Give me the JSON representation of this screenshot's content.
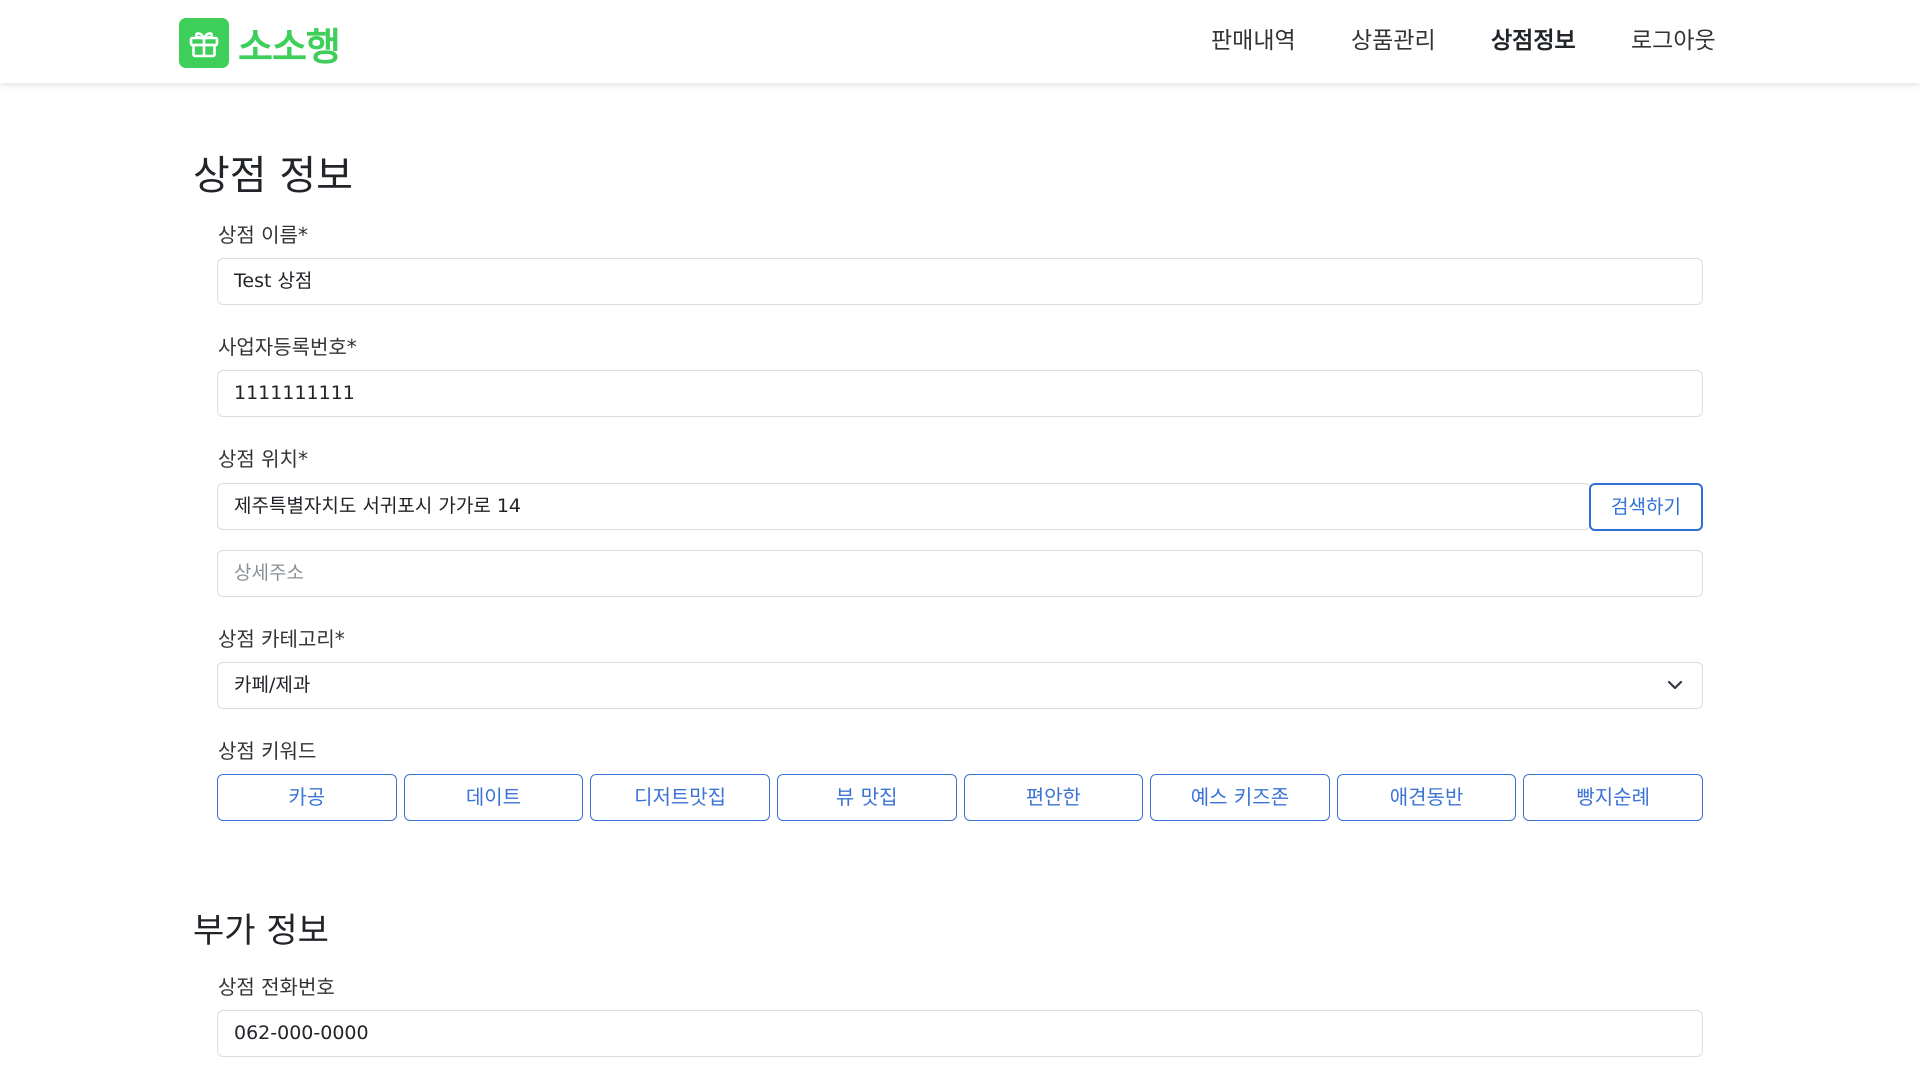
{
  "nav": {
    "brand": "소소행",
    "links": [
      "판매내역",
      "상품관리",
      "상점정보",
      "로그아웃"
    ]
  },
  "store_info": {
    "title": "상점 정보",
    "name_label": "상점 이름*",
    "name_value": "Test 상점",
    "biz_label": "사업자등록번호*",
    "biz_value": "1111111111",
    "location_label": "상점 위치*",
    "location_value": "제주특별자치도 서귀포시 가가로 14",
    "search_button": "검색하기",
    "detail_placeholder": "상세주소",
    "category_label": "상점 카테고리*",
    "category_value": "카페/제과",
    "keyword_label": "상점 키워드",
    "keywords": [
      "카공",
      "데이트",
      "디저트맛집",
      "뷰 맛집",
      "편안한",
      "예스 키즈존",
      "애견동반",
      "빵지순례"
    ]
  },
  "extra_info": {
    "title": "부가 정보",
    "phone_label": "상점 전화번호",
    "phone_value": "062-000-0000"
  },
  "colors": {
    "brand_green": "#3ecf5a",
    "accent_blue": "#2f6fd6"
  }
}
